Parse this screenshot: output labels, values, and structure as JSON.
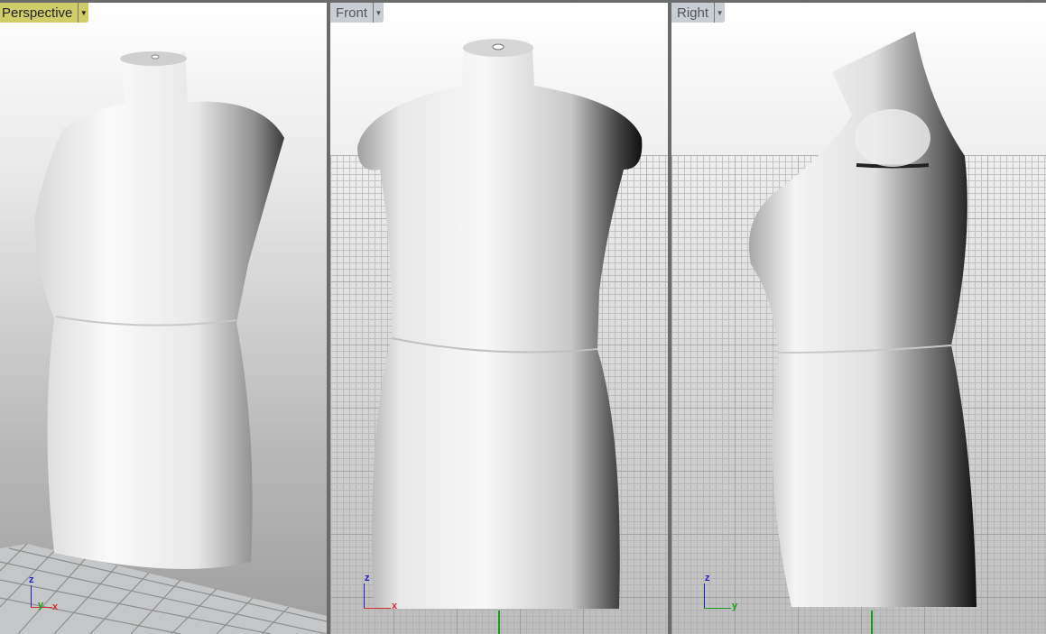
{
  "viewports": [
    {
      "label": "Perspective",
      "active": true,
      "axes": [
        "z",
        "y",
        "x"
      ]
    },
    {
      "label": "Front",
      "active": false,
      "axes": [
        "z",
        "x"
      ]
    },
    {
      "label": "Right",
      "active": false,
      "axes": [
        "z",
        "y"
      ]
    }
  ],
  "colors": {
    "active_label": "#cfcc6a",
    "inactive_label": "#c9cdd4",
    "x_axis": "#d03030",
    "y_axis": "#1a9a1a",
    "z_axis": "#2020c0"
  }
}
